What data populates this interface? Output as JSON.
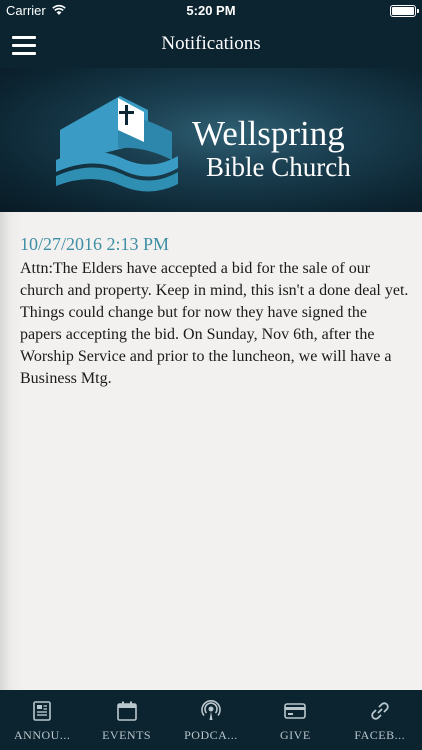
{
  "status_bar": {
    "carrier": "Carrier",
    "time": "5:20 PM",
    "battery_level": 1.0
  },
  "nav": {
    "title": "Notifications",
    "menu_icon": "hamburger-menu-icon"
  },
  "hero": {
    "brand_line1": "Wellspring",
    "brand_line2": "Bible Church",
    "logo_icon": "cross-bible-waves-logo",
    "colors": {
      "logo_blue": "#2f8fb3",
      "bg_dark": "#0d2633"
    }
  },
  "notification": {
    "date": "10/27/2016 2:13 PM",
    "body": "Attn:The Elders have accepted a bid for the sale of our church and property. Keep in mind, this isn't a done deal yet. Things could change but for now they have signed the papers accepting the bid. On Sunday, Nov 6th, after the Worship Service and prior to the luncheon, we will have a Business Mtg."
  },
  "tabs": [
    {
      "label": "ANNOU...",
      "icon": "newspaper-icon"
    },
    {
      "label": "EVENTS",
      "icon": "calendar-icon"
    },
    {
      "label": "PODCA...",
      "icon": "podcast-icon"
    },
    {
      "label": "GIVE",
      "icon": "credit-card-icon"
    },
    {
      "label": "FACEB...",
      "icon": "link-icon"
    }
  ],
  "colors": {
    "bar_bg": "#0b2430",
    "date_color": "#3d8fa6",
    "tab_text": "#b9c6cc"
  }
}
